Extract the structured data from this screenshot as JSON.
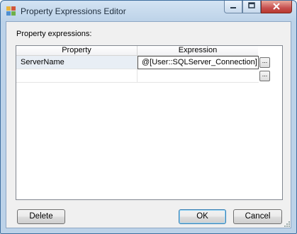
{
  "window": {
    "title": "Property Expressions Editor",
    "accent": "#3f6f9f",
    "close_color": "#c75050"
  },
  "group_label": "Property expressions:",
  "grid": {
    "columns": [
      "Property",
      "Expression"
    ],
    "rows": [
      {
        "property": "ServerName",
        "expression": "@[User::SQLServer_Connection]"
      },
      {
        "property": "",
        "expression": ""
      }
    ],
    "ellipsis_label": "..."
  },
  "buttons": {
    "delete": "Delete",
    "ok": "OK",
    "cancel": "Cancel"
  },
  "icons": {
    "app": "property-editor-icon",
    "minimize": "minimize-icon",
    "maximize": "maximize-icon",
    "close": "close-icon"
  }
}
